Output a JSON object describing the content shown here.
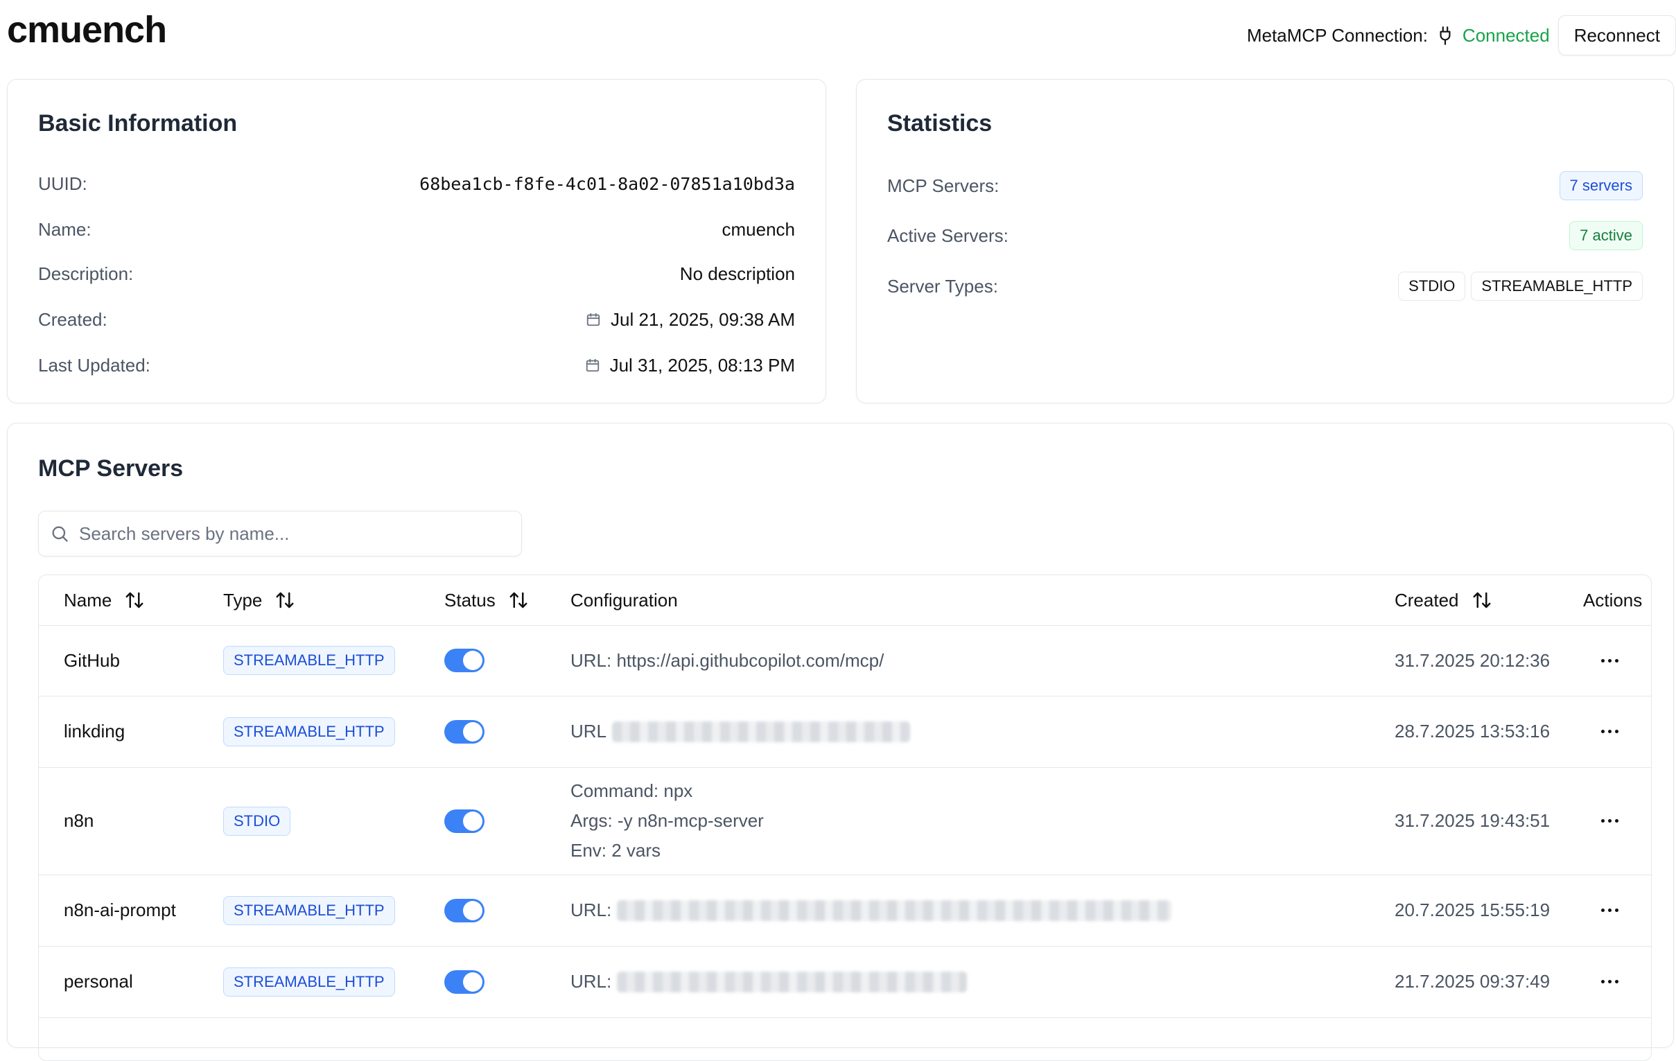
{
  "header": {
    "title": "cmuench",
    "connection_label": "MetaMCP Connection:",
    "connection_status": "Connected",
    "reconnect_label": "Reconnect",
    "status_color": "#16a34a"
  },
  "basic_info": {
    "heading": "Basic Information",
    "uuid_label": "UUID:",
    "uuid_value": "68bea1cb-f8fe-4c01-8a02-07851a10bd3a",
    "name_label": "Name:",
    "name_value": "cmuench",
    "description_label": "Description:",
    "description_value": "No description",
    "created_label": "Created:",
    "created_value": "Jul 21, 2025, 09:38 AM",
    "updated_label": "Last Updated:",
    "updated_value": "Jul 31, 2025, 08:13 PM"
  },
  "statistics": {
    "heading": "Statistics",
    "servers_label": "MCP Servers:",
    "servers_value": "7 servers",
    "active_label": "Active Servers:",
    "active_value": "7 active",
    "types_label": "Server Types:",
    "types": [
      "STDIO",
      "STREAMABLE_HTTP"
    ]
  },
  "servers": {
    "heading": "MCP Servers",
    "search_placeholder": "Search servers by name...",
    "columns": {
      "name": "Name",
      "type": "Type",
      "status": "Status",
      "configuration": "Configuration",
      "created": "Created",
      "actions": "Actions"
    },
    "rows": [
      {
        "name": "GitHub",
        "type": "STREAMABLE_HTTP",
        "enabled": true,
        "config": [
          "URL: https://api.githubcopilot.com/mcp/"
        ],
        "created": "31.7.2025 20:12:36"
      },
      {
        "name": "linkding",
        "type": "STREAMABLE_HTTP",
        "enabled": true,
        "config": [
          "URL"
        ],
        "created": "28.7.2025 13:53:16"
      },
      {
        "name": "n8n",
        "type": "STDIO",
        "enabled": true,
        "config": [
          "Command: npx",
          "Args: -y n8n-mcp-server",
          "Env: 2 vars"
        ],
        "created": "31.7.2025 19:43:51"
      },
      {
        "name": "n8n-ai-prompt",
        "type": "STREAMABLE_HTTP",
        "enabled": true,
        "config": [
          "URL:"
        ],
        "created": "20.7.2025 15:55:19"
      },
      {
        "name": "personal",
        "type": "STREAMABLE_HTTP",
        "enabled": true,
        "config": [
          "URL:"
        ],
        "created": "21.7.2025 09:37:49"
      }
    ]
  },
  "icons": {
    "plug": "plug-icon",
    "calendar": "calendar-icon",
    "search": "search-icon",
    "sort": "sort-arrows-icon",
    "more": "more-horizontal-icon"
  }
}
